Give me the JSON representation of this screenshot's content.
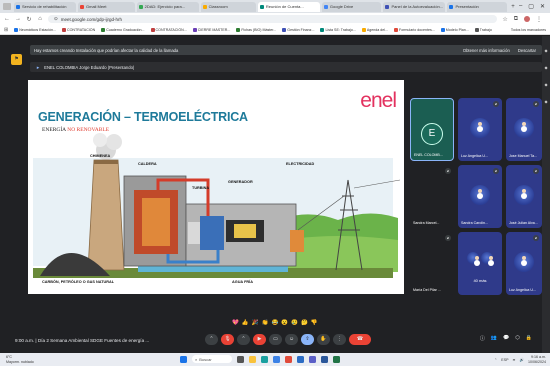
{
  "browser": {
    "tabs": [
      {
        "label": "Servicio de rehabilitación",
        "color": "#1a73e8"
      },
      {
        "label": "Gmail Meet",
        "color": "#ea4335"
      },
      {
        "label": "2DAD: Ejercicio para...",
        "color": "#34a853"
      },
      {
        "label": "Classroom",
        "color": "#f9ab00"
      },
      {
        "label": "Reunión de Cuenta...",
        "color": "#00897b",
        "active": true
      },
      {
        "label": "Google Drive",
        "color": "#4285f4"
      },
      {
        "label": "Panel de la Autoevaluación...",
        "color": "#3f51b5"
      },
      {
        "label": "Presentación",
        "color": "#1a73e8"
      }
    ],
    "url": "meet.google.com/gdp-ijrgd-hrh",
    "bookmarks": [
      "Neumáticos Estación...",
      "CONTRATACIÓN",
      "Cuaderno Graduación...",
      "CONTRATACIÓN...",
      "CIERRE MÁSTER...",
      "Fichas (BIO) Máster...",
      "Gestión Finanz...",
      "Lista SE: Trabajo...",
      "Agenda del...",
      "Formulario docentes...",
      "Modelo Plan...",
      "Trabajo"
    ],
    "bookmarks_right": "Todos los marcadores"
  },
  "meet": {
    "notice_text": "Hay estamos creando Instalación que podrían afectar la calidad de la llamada",
    "notice_more": "Obtener más información",
    "notice_dismiss": "Descartar",
    "presenter_label": "ENEL COLOMBIA Jorge Eduardo (Presentando)",
    "slide": {
      "title": "GENERACIÓN – TERMOELÉCTRICA",
      "subtitle_prefix": "ENERGÍA",
      "subtitle_highlight": "NO RENOVABLE",
      "logo": "enel",
      "labels": {
        "chimenea": "CHIMENEA",
        "caldera": "CALDERA",
        "turbina": "TURBINA",
        "generador": "GENERADOR",
        "electricidad": "ELECTRICIDAD",
        "combustible": "CARBÓN, PETRÓLEO O GAS NATURAL",
        "agua": "AGUA FRÍA"
      }
    },
    "participants": [
      {
        "name": "ENEL COLOMB...",
        "type": "initial",
        "initial": "E"
      },
      {
        "name": "Luz Angelica U...",
        "type": "image"
      },
      {
        "name": "Jose Manuel Ta...",
        "type": "image"
      },
      {
        "name": "Sandra Marcel...",
        "type": "blank"
      },
      {
        "name": "Sandra Carolin...",
        "type": "image"
      },
      {
        "name": "José Julian Alva...",
        "type": "image"
      },
      {
        "name": "María Del Pilar ...",
        "type": "blank"
      },
      {
        "name": "40 más",
        "type": "more"
      },
      {
        "name": "Luz Angelica U...",
        "type": "image"
      }
    ],
    "meeting_time": "9:00 a.m.",
    "meeting_title": "Día 2 Semana Ambiental SDGE Fuentes de energía ...",
    "reaction_emojis": [
      "💖",
      "👍",
      "🎉",
      "👏",
      "😂",
      "😮",
      "😢",
      "🤔",
      "👎"
    ]
  },
  "taskbar": {
    "weather_temp": "6°C",
    "weather_desc": "Mayorm. nublado",
    "search_placeholder": "Buscar",
    "lang": "ESP",
    "clock_time": "9:16 a.m.",
    "clock_date": "10/06/2024"
  }
}
